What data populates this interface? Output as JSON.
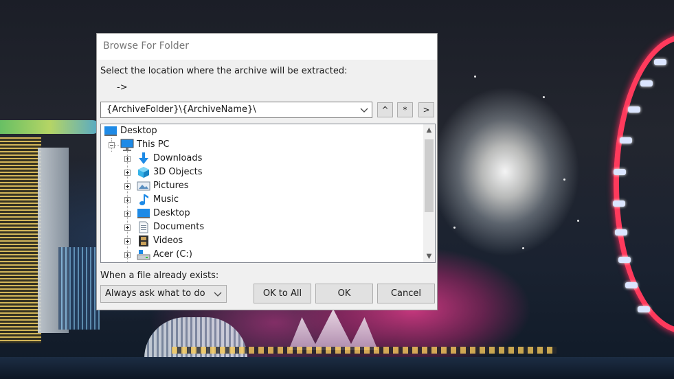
{
  "dialog": {
    "title": "Browse For Folder",
    "prompt": "Select the location where the archive will be extracted:",
    "arrow_text": "->",
    "path": {
      "value": "{ArchiveFolder}\\{ArchiveName}\\"
    },
    "path_buttons": [
      {
        "label": "^",
        "icon": "caret-up-icon"
      },
      {
        "label": "*",
        "icon": "asterisk-icon"
      },
      {
        "label": ">",
        "icon": "chevron-right-icon"
      }
    ],
    "tree": {
      "root": {
        "label": "Desktop",
        "icon": "desktop-icon"
      },
      "this_pc": {
        "label": "This PC",
        "icon": "computer-icon"
      },
      "items": [
        {
          "label": "Downloads",
          "icon": "downloads-arrow-icon"
        },
        {
          "label": "3D Objects",
          "icon": "3d-objects-cube-icon"
        },
        {
          "label": "Pictures",
          "icon": "pictures-icon"
        },
        {
          "label": "Music",
          "icon": "music-note-icon"
        },
        {
          "label": "Desktop",
          "icon": "desktop-icon"
        },
        {
          "label": "Documents",
          "icon": "documents-icon"
        },
        {
          "label": "Videos",
          "icon": "videos-filmstrip-icon"
        },
        {
          "label": "Acer (C:)",
          "icon": "drive-icon"
        }
      ]
    },
    "exists": {
      "label": "When a file already exists:",
      "selected": "Always ask what to do"
    },
    "buttons": {
      "ok_to_all": "OK to All",
      "ok": "OK",
      "cancel": "Cancel"
    }
  },
  "colors": {
    "dialog_bg": "#f0f0f0",
    "accent_blue": "#1e8ae6",
    "wheel_red": "#ff3a5c"
  }
}
